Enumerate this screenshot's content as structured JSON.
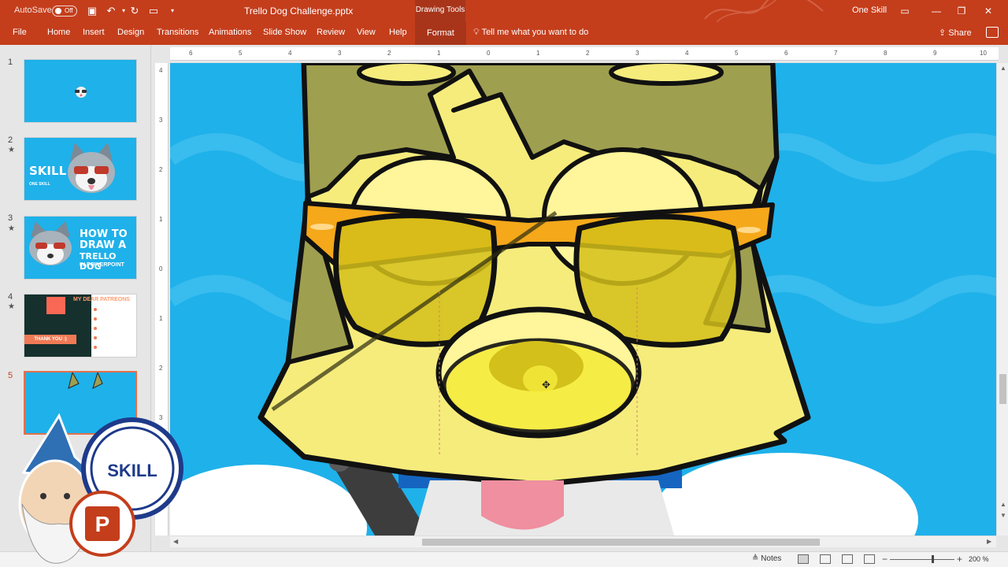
{
  "titlebar": {
    "autosave_label": "AutoSave",
    "autosave_state": "Off",
    "document_title": "Trello Dog Challenge.pptx",
    "context_group": "Drawing Tools",
    "user_name": "One Skill"
  },
  "ribbon": {
    "tabs": [
      {
        "label": "File"
      },
      {
        "label": "Home"
      },
      {
        "label": "Insert"
      },
      {
        "label": "Design"
      },
      {
        "label": "Transitions"
      },
      {
        "label": "Animations"
      },
      {
        "label": "Slide Show"
      },
      {
        "label": "Review"
      },
      {
        "label": "View"
      },
      {
        "label": "Help"
      },
      {
        "label": "Format"
      }
    ],
    "active_tab": "Format",
    "tell_me": "Tell me what you want to do",
    "share": "Share"
  },
  "slides": [
    {
      "number": "1",
      "starred": false
    },
    {
      "number": "2",
      "starred": true,
      "caption": "ONE SKILL"
    },
    {
      "number": "3",
      "starred": true,
      "headline": [
        "HOW TO",
        "DRAW A",
        "TRELLO DOG"
      ],
      "subline": "IN POWERPOINT"
    },
    {
      "number": "4",
      "starred": true,
      "headline": "MY DEAR PATREONS",
      "thanks": "THANK YOU :)"
    },
    {
      "number": "5",
      "starred": false,
      "selected": true
    }
  ],
  "rulers": {
    "horizontal": [
      "6",
      "5",
      "4",
      "3",
      "2",
      "1",
      "0",
      "1",
      "2",
      "3",
      "4",
      "5",
      "6",
      "7",
      "8",
      "9",
      "10"
    ],
    "vertical": [
      "4",
      "3",
      "2",
      "1",
      "0",
      "1",
      "2",
      "3"
    ]
  },
  "statusbar": {
    "notes": "Notes",
    "zoom": "200 %"
  },
  "colors": {
    "accent": "#c43e1c",
    "slide_bg": "#1fb1ea",
    "fur_olive": "#9f9f50",
    "fur_yellow": "#f6ec7c",
    "glasses_orange": "#f5a81a",
    "lens": "#d3c01a"
  },
  "logo": {
    "brand": "SKILL",
    "app_icon": "P"
  }
}
